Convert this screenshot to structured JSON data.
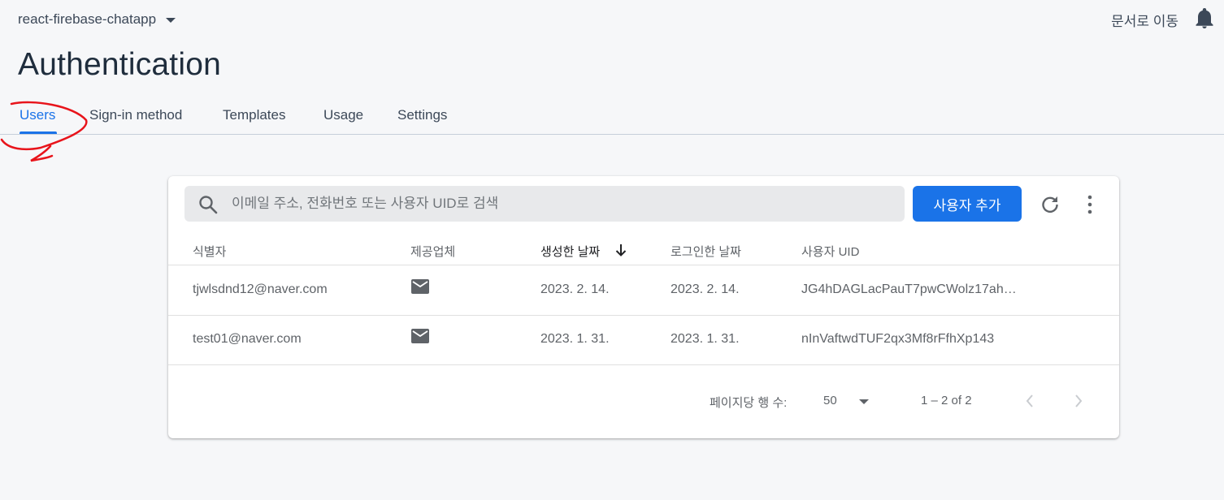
{
  "header": {
    "project_name": "react-firebase-chatapp",
    "docs_link": "문서로 이동"
  },
  "page": {
    "title": "Authentication"
  },
  "tabs": [
    {
      "label": "Users",
      "active": true
    },
    {
      "label": "Sign-in method",
      "active": false
    },
    {
      "label": "Templates",
      "active": false
    },
    {
      "label": "Usage",
      "active": false
    },
    {
      "label": "Settings",
      "active": false
    }
  ],
  "toolbar": {
    "search_placeholder": "이메일 주소, 전화번호 또는 사용자 UID로 검색",
    "add_user_label": "사용자 추가"
  },
  "table": {
    "columns": [
      "식별자",
      "제공업체",
      "생성한 날짜",
      "로그인한 날짜",
      "사용자 UID"
    ],
    "sorted_column": "생성한 날짜",
    "rows": [
      {
        "identifier": "tjwlsdnd12@naver.com",
        "provider": "mail-icon",
        "created": "2023. 2. 14.",
        "signed_in": "2023. 2. 14.",
        "uid": "JG4hDAGLacPauT7pwCWolz17ah…"
      },
      {
        "identifier": "test01@naver.com",
        "provider": "mail-icon",
        "created": "2023. 1. 31.",
        "signed_in": "2023. 1. 31.",
        "uid": "nInVaftwdTUF2qx3Mf8rFfhXp143"
      }
    ]
  },
  "pagination": {
    "rows_per_page_label": "페이지당 행 수:",
    "rows_per_page": "50",
    "range": "1 – 2 of 2"
  },
  "colors": {
    "accent": "#1a73e8",
    "annotation": "#e8141b"
  }
}
